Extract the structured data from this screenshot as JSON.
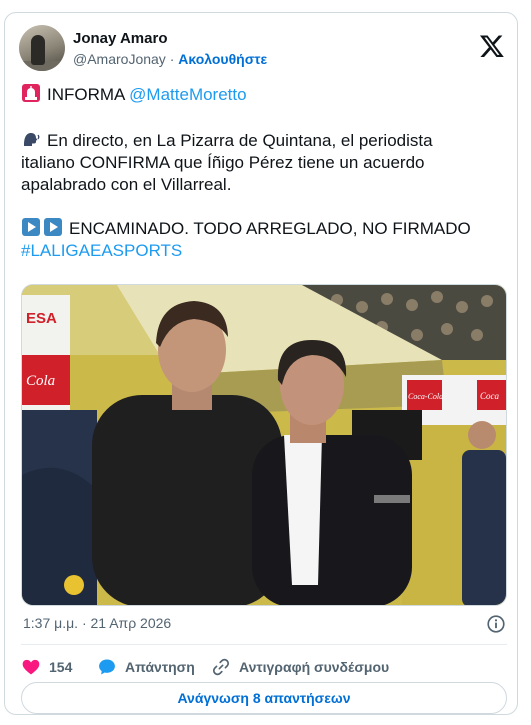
{
  "author": {
    "name": "Jonay Amaro",
    "handle": "@AmaroJonay",
    "separator": "·",
    "follow_label": "Ακολουθήστε"
  },
  "tweet": {
    "line1_text": "INFORMA ",
    "line1_mention": "@MatteMoretto",
    "para2_line1": "En directo, en La Pizarra de Quintana, el periodista",
    "para2_line2": "italiano CONFIRMA que Íñigo Pérez tiene un acuerdo",
    "para2_line3": "apalabrado con el Villarreal.",
    "para3_text": "ENCAMINADO. TODO ARREGLADO, NO FIRMADO",
    "hashtag": "#LALIGAEASPORTS",
    "photo_sign_left": "ESA",
    "photo_sign_left2": "Cola",
    "photo_sign_right1": "Coca-Cola",
    "photo_sign_right2": "Coca"
  },
  "meta": {
    "time": "1:37 μ.μ.",
    "sep": "·",
    "date": "21 Απρ 2026"
  },
  "actions": {
    "likes": "154",
    "reply_label": "Απάντηση",
    "copy_label": "Αντιγραφή συνδέσμου"
  },
  "read_replies_label": "Ανάγνωση 8 απαντήσεων",
  "colors": {
    "link": "#1d9bf0",
    "follow": "#006fd6",
    "heart": "#f91880",
    "reply": "#1d9bf0"
  }
}
